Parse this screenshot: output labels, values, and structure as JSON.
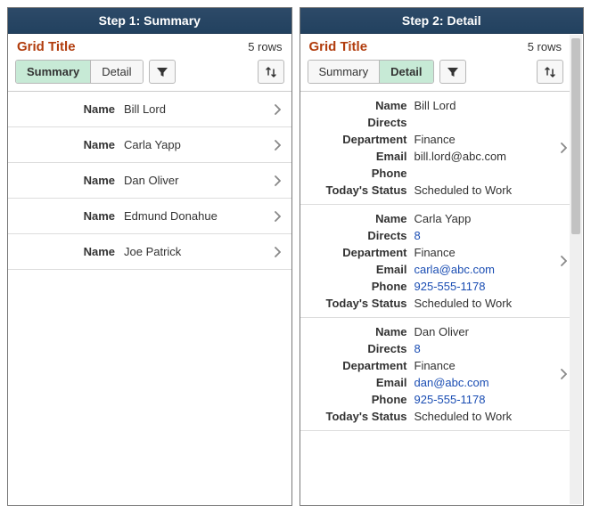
{
  "labels": {
    "name": "Name",
    "directs": "Directs",
    "department": "Department",
    "email": "Email",
    "phone": "Phone",
    "status": "Today's Status"
  },
  "buttons": {
    "summary": "Summary",
    "detail": "Detail"
  },
  "left": {
    "header": "Step 1: Summary",
    "title": "Grid Title",
    "count": "5 rows",
    "rows": [
      {
        "name": "Bill Lord"
      },
      {
        "name": "Carla Yapp"
      },
      {
        "name": "Dan Oliver"
      },
      {
        "name": "Edmund Donahue"
      },
      {
        "name": "Joe Patrick"
      }
    ]
  },
  "right": {
    "header": "Step 2: Detail",
    "title": "Grid Title",
    "count": "5 rows",
    "rows": [
      {
        "name": "Bill Lord",
        "directs": "",
        "department": "Finance",
        "email": "bill.lord@abc.com",
        "email_link": false,
        "phone": "",
        "phone_link": false,
        "status": "Scheduled to Work"
      },
      {
        "name": "Carla Yapp",
        "directs": "8",
        "department": "Finance",
        "email": "carla@abc.com",
        "email_link": true,
        "phone": "925-555-1178",
        "phone_link": true,
        "status": "Scheduled to Work"
      },
      {
        "name": "Dan Oliver",
        "directs": "8",
        "department": "Finance",
        "email": "dan@abc.com",
        "email_link": true,
        "phone": "925-555-1178",
        "phone_link": true,
        "status": "Scheduled to Work"
      }
    ]
  }
}
